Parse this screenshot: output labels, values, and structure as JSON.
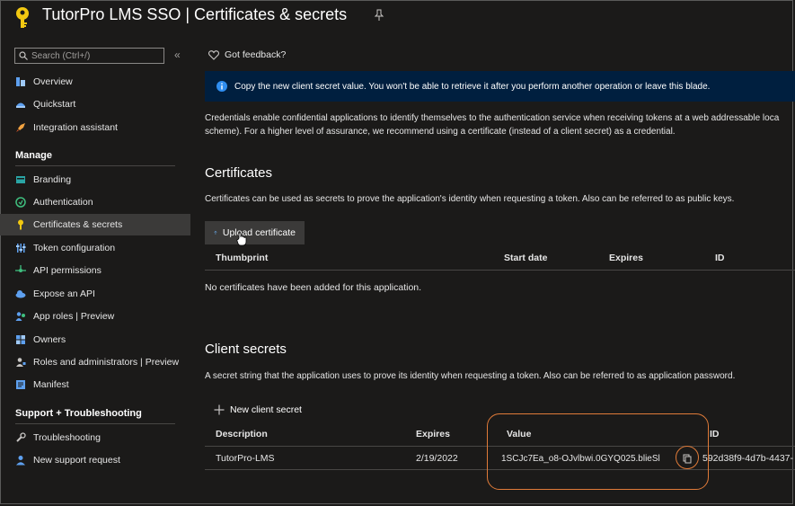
{
  "header": {
    "title": "TutorPro LMS SSO | Certificates & secrets",
    "brand_color": "#f2c811"
  },
  "sidebar": {
    "search_placeholder": "Search (Ctrl+/)",
    "collapse_glyph": "«",
    "items_top": [
      {
        "label": "Overview",
        "icon": "overview-icon"
      },
      {
        "label": "Quickstart",
        "icon": "quickstart-icon"
      },
      {
        "label": "Integration assistant",
        "icon": "rocket-icon"
      }
    ],
    "manage_title": "Manage",
    "items_manage": [
      {
        "label": "Branding",
        "icon": "branding-icon"
      },
      {
        "label": "Authentication",
        "icon": "authentication-icon"
      },
      {
        "label": "Certificates & secrets",
        "icon": "key-icon",
        "active": true
      },
      {
        "label": "Token configuration",
        "icon": "token-config-icon"
      },
      {
        "label": "API permissions",
        "icon": "api-permissions-icon"
      },
      {
        "label": "Expose an API",
        "icon": "cloud-icon"
      },
      {
        "label": "App roles | Preview",
        "icon": "app-roles-icon"
      },
      {
        "label": "Owners",
        "icon": "owners-icon"
      },
      {
        "label": "Roles and administrators | Preview",
        "icon": "roles-admin-icon"
      },
      {
        "label": "Manifest",
        "icon": "manifest-icon"
      }
    ],
    "support_title": "Support + Troubleshooting",
    "items_support": [
      {
        "label": "Troubleshooting",
        "icon": "wrench-icon"
      },
      {
        "label": "New support request",
        "icon": "support-person-icon"
      }
    ]
  },
  "main": {
    "feedback_label": "Got feedback?",
    "info_text": "Copy the new client secret value. You won't be able to retrieve it after you perform another operation or leave this blade.",
    "credentials_desc_1": "Credentials enable confidential applications to identify themselves to the authentication service when receiving tokens at a web addressable loca",
    "credentials_desc_2": "scheme). For a higher level of assurance, we recommend using a certificate (instead of a client secret) as a credential.",
    "certificates": {
      "title": "Certificates",
      "desc": "Certificates can be used as secrets to prove the application's identity when requesting a token. Also can be referred to as public keys.",
      "upload_label": "Upload certificate",
      "columns": [
        "Thumbprint",
        "Start date",
        "Expires",
        "ID"
      ],
      "empty_text": "No certificates have been added for this application."
    },
    "client_secrets": {
      "title": "Client secrets",
      "desc": "A secret string that the application uses to prove its identity when requesting a token. Also can be referred to as application password.",
      "new_label": "New client secret",
      "columns": [
        "Description",
        "Expires",
        "Value",
        "ID"
      ],
      "rows": [
        {
          "description": "TutorPro-LMS",
          "expires": "2/19/2022",
          "value": "1SCJc7Ea_o8-OJvlbwi.0GYQ025.blieSl",
          "id": "592d38f9-4d7b-4437-"
        }
      ]
    },
    "colors": {
      "accent": "#0078d4",
      "highlight": "#e07b39",
      "info_bg": "#001f3f"
    }
  }
}
